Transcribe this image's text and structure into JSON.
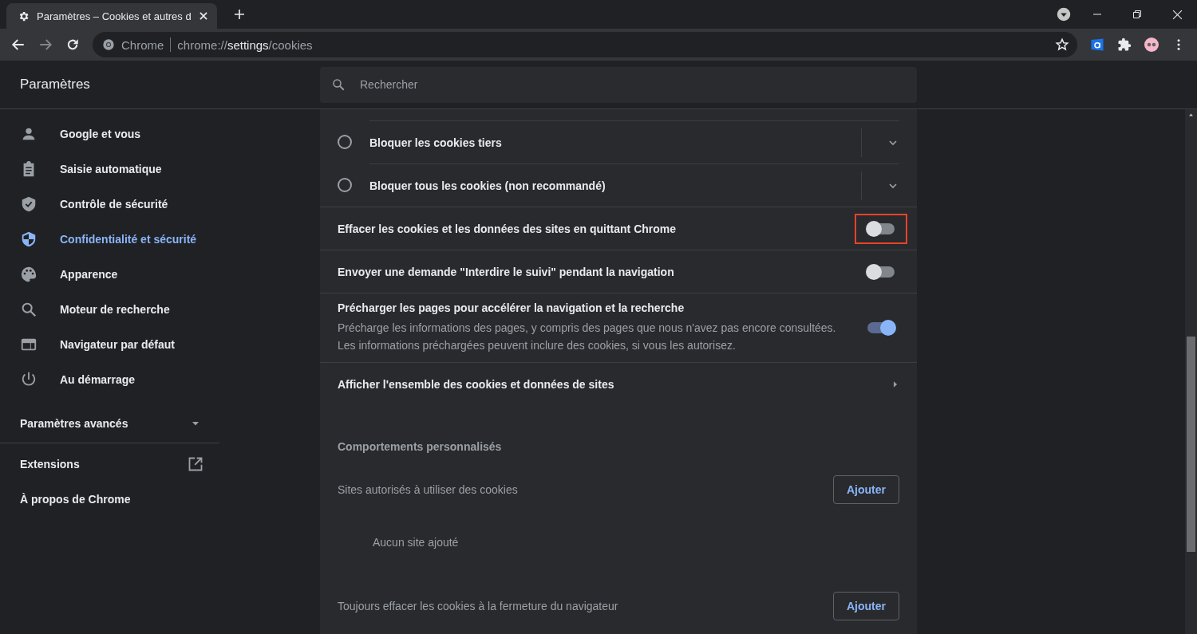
{
  "window": {
    "tabs": [
      {
        "title": "Paramètres – Cookies et autres d",
        "selected": true
      }
    ],
    "address": {
      "origin": "Chrome",
      "url": "chrome://**settings**/cookies"
    }
  },
  "header": {
    "title": "Paramètres",
    "search": {
      "placeholder": "Rechercher"
    }
  },
  "sidebar": {
    "items": [
      {
        "label": "Google et vous",
        "selected": false
      },
      {
        "label": "Saisie automatique",
        "selected": false
      },
      {
        "label": "Contrôle de sécurité",
        "selected": false
      },
      {
        "label": "Confidentialité et sécurité",
        "selected": true
      },
      {
        "label": "Apparence",
        "selected": false
      },
      {
        "label": "Moteur de recherche",
        "selected": false
      },
      {
        "label": "Navigateur par défaut",
        "selected": false
      },
      {
        "label": "Au démarrage",
        "selected": false
      }
    ],
    "advanced": {
      "label": "Paramètres avancés",
      "expanded": false
    },
    "links": [
      {
        "label": "Extensions",
        "kind": "external"
      },
      {
        "label": "À propos de Chrome",
        "kind": "plain"
      }
    ]
  },
  "content": {
    "rows": [
      {
        "kind": "radio",
        "label": "Bloquer les cookies tiers",
        "selected": false
      },
      {
        "kind": "radio",
        "label": "Bloquer tous les cookies (non recommandé)",
        "selected": false
      },
      {
        "kind": "toggle",
        "label": "Effacer les cookies et les données des sites en quittant Chrome",
        "on": false,
        "highlighted": true
      },
      {
        "kind": "toggle",
        "label": "Envoyer une demande \"Interdire le suivi\" pendant la navigation",
        "on": false,
        "highlighted": false
      },
      {
        "kind": "toggle",
        "label": "Précharger les pages pour accélérer la navigation et la recherche",
        "description": [
          "Précharge les informations des pages, y compris des pages que nous n'avez pas encore consultées.",
          "Les informations préchargées peuvent inclure des cookies, si vous les autorisez."
        ],
        "on": true,
        "highlighted": false
      },
      {
        "kind": "link",
        "label": "Afficher l'ensemble des cookies et données de sites"
      },
      {
        "kind": "heading",
        "label": "Comportements personnalisés"
      },
      {
        "kind": "sites",
        "label": "Sites autorisés à utiliser des cookies",
        "button": "Ajouter",
        "empty": "Aucun site ajouté"
      },
      {
        "kind": "sites",
        "label": "Toujours effacer les cookies à la fermeture du navigateur",
        "button": "Ajouter"
      }
    ]
  }
}
